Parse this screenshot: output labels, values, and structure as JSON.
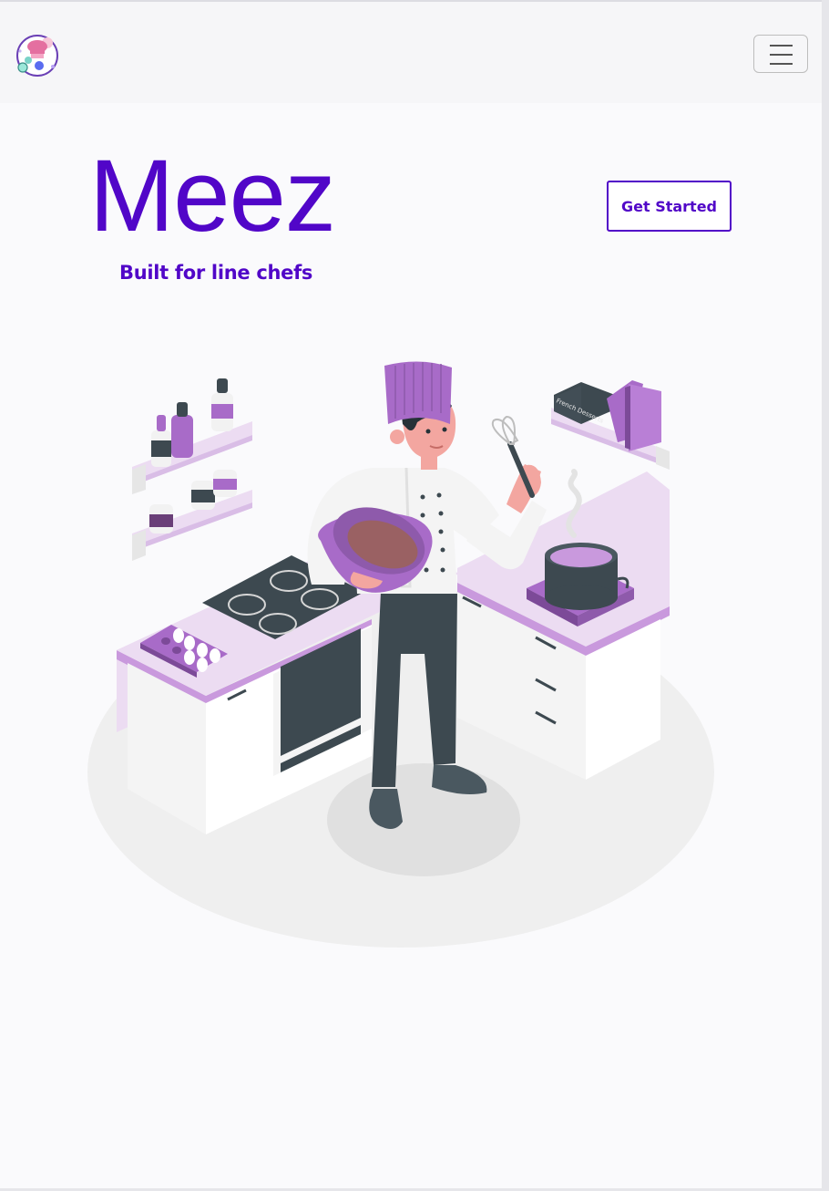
{
  "navbar": {
    "logo_icon": "chef-hat-logo-icon",
    "toggler_icon": "hamburger-menu-icon"
  },
  "hero": {
    "title": "Meez",
    "tagline": "Built for line chefs",
    "cta_label": "Get Started"
  },
  "illustration": {
    "book_spine_text": "French Desserts"
  },
  "colors": {
    "brand": "#5106c8",
    "accent_purple": "#a86bc8",
    "light_purple": "#ecdcf2",
    "dark_gray": "#3d4950"
  }
}
